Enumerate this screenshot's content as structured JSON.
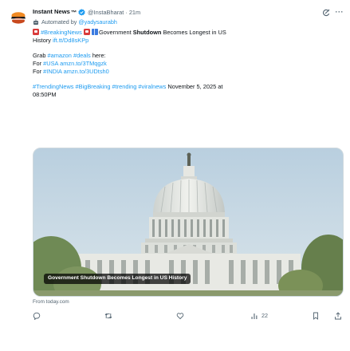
{
  "author": {
    "display_name": "Instant News",
    "trademark": "™",
    "handle": "@InstaBharat",
    "separator": "·",
    "time": "21m"
  },
  "automated": {
    "prefix": "Automated by",
    "by_handle": "@yadysaurabh"
  },
  "tweet": {
    "hashtag_breaking": "#BreakingNews",
    "headline_pre": "Government ",
    "headline_bold": "Shutdown",
    "headline_post": " Becomes Longest in US",
    "headline_line2": "History",
    "short_link": "ift.tt/Dd8sKPp",
    "grab_prefix": "Grab",
    "grab_tag1": "#amazon",
    "grab_tag2": "#deals",
    "grab_suffix": "here:",
    "usa_prefix": "For",
    "usa_tag": "#USA",
    "usa_link": "amzn.to/3TMqgzk",
    "india_prefix": "For",
    "india_tag": "#INDIA",
    "india_link": "amzn.to/3UDtsh0",
    "tags_line": "#TrendingNews #BigBreaking #trending #viralnews",
    "dateline": "November 5, 2025 at",
    "dateline_time": "08:50PM"
  },
  "media": {
    "caption": "Government Shutdown Becomes Longest in US History",
    "alt": "US Capitol building dome"
  },
  "card_source": "From today.com",
  "actions": {
    "reply_count": "",
    "repost_count": "",
    "like_count": "",
    "views_count": "22"
  },
  "colors": {
    "link": "#1d9bf0",
    "text": "#0f1419",
    "secondary": "#536471",
    "verified": "#1d9bf0"
  },
  "icons": [
    "avatar-logo",
    "verified-badge-icon",
    "grok-icon",
    "more-icon",
    "bot-icon",
    "reply-icon",
    "repost-icon",
    "like-icon",
    "views-icon",
    "bookmark-icon",
    "share-icon"
  ]
}
